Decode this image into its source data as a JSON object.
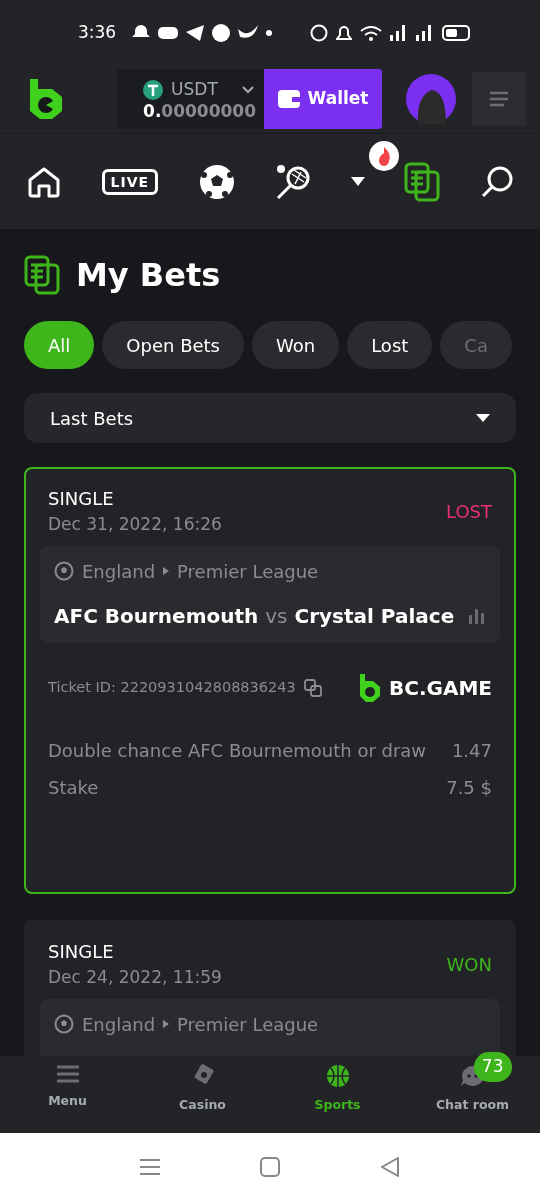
{
  "status_bar": {
    "time": "3:36"
  },
  "header": {
    "currency": "USDT",
    "balance_whole": "0.",
    "balance_fraction": "00000000",
    "wallet_button": "Wallet"
  },
  "sport_nav": [
    {
      "kind": "home",
      "selected": false
    },
    {
      "kind": "live",
      "label": "LIVE",
      "selected": false
    },
    {
      "kind": "soccer",
      "selected": false
    },
    {
      "kind": "tennis",
      "selected": false
    },
    {
      "kind": "more",
      "selected": false
    },
    {
      "kind": "bets",
      "selected": true
    },
    {
      "kind": "search",
      "selected": false
    }
  ],
  "page_title": "My Bets",
  "filters": [
    {
      "label": "All",
      "selected": true
    },
    {
      "label": "Open Bets",
      "selected": false
    },
    {
      "label": "Won",
      "selected": false
    },
    {
      "label": "Lost",
      "selected": false
    },
    {
      "label": "Ca",
      "selected": false
    }
  ],
  "period_select": {
    "value": "Last Bets"
  },
  "bets": [
    {
      "type": "SINGLE",
      "date": "Dec 31, 2022, 16:26",
      "result": "LOST",
      "color": "#ea2d7a",
      "highlighted": true,
      "country": "England",
      "league": "Premier League",
      "home": "AFC Bournemouth",
      "vs": "vs",
      "away": "Crystal Palace",
      "ticket_id": "Ticket ID: 2220931042808836243",
      "brand": "BC.GAME",
      "selection": "Double chance AFC Bournemouth or draw",
      "odds": "1.47",
      "stake_label": "Stake",
      "stake": "7.5 $"
    },
    {
      "type": "SINGLE",
      "date": "Dec 24, 2022, 11:59",
      "result": "WON",
      "color": "#3fb51c",
      "highlighted": false,
      "country": "England",
      "league": "Premier League"
    }
  ],
  "bottom_nav": [
    {
      "kind": "menu",
      "label": "Menu",
      "selected": false
    },
    {
      "kind": "casino",
      "label": "Casino",
      "selected": false
    },
    {
      "kind": "sports",
      "label": "Sports",
      "selected": true
    },
    {
      "kind": "chat",
      "label": "Chat room",
      "selected": false,
      "badge": "73"
    }
  ]
}
